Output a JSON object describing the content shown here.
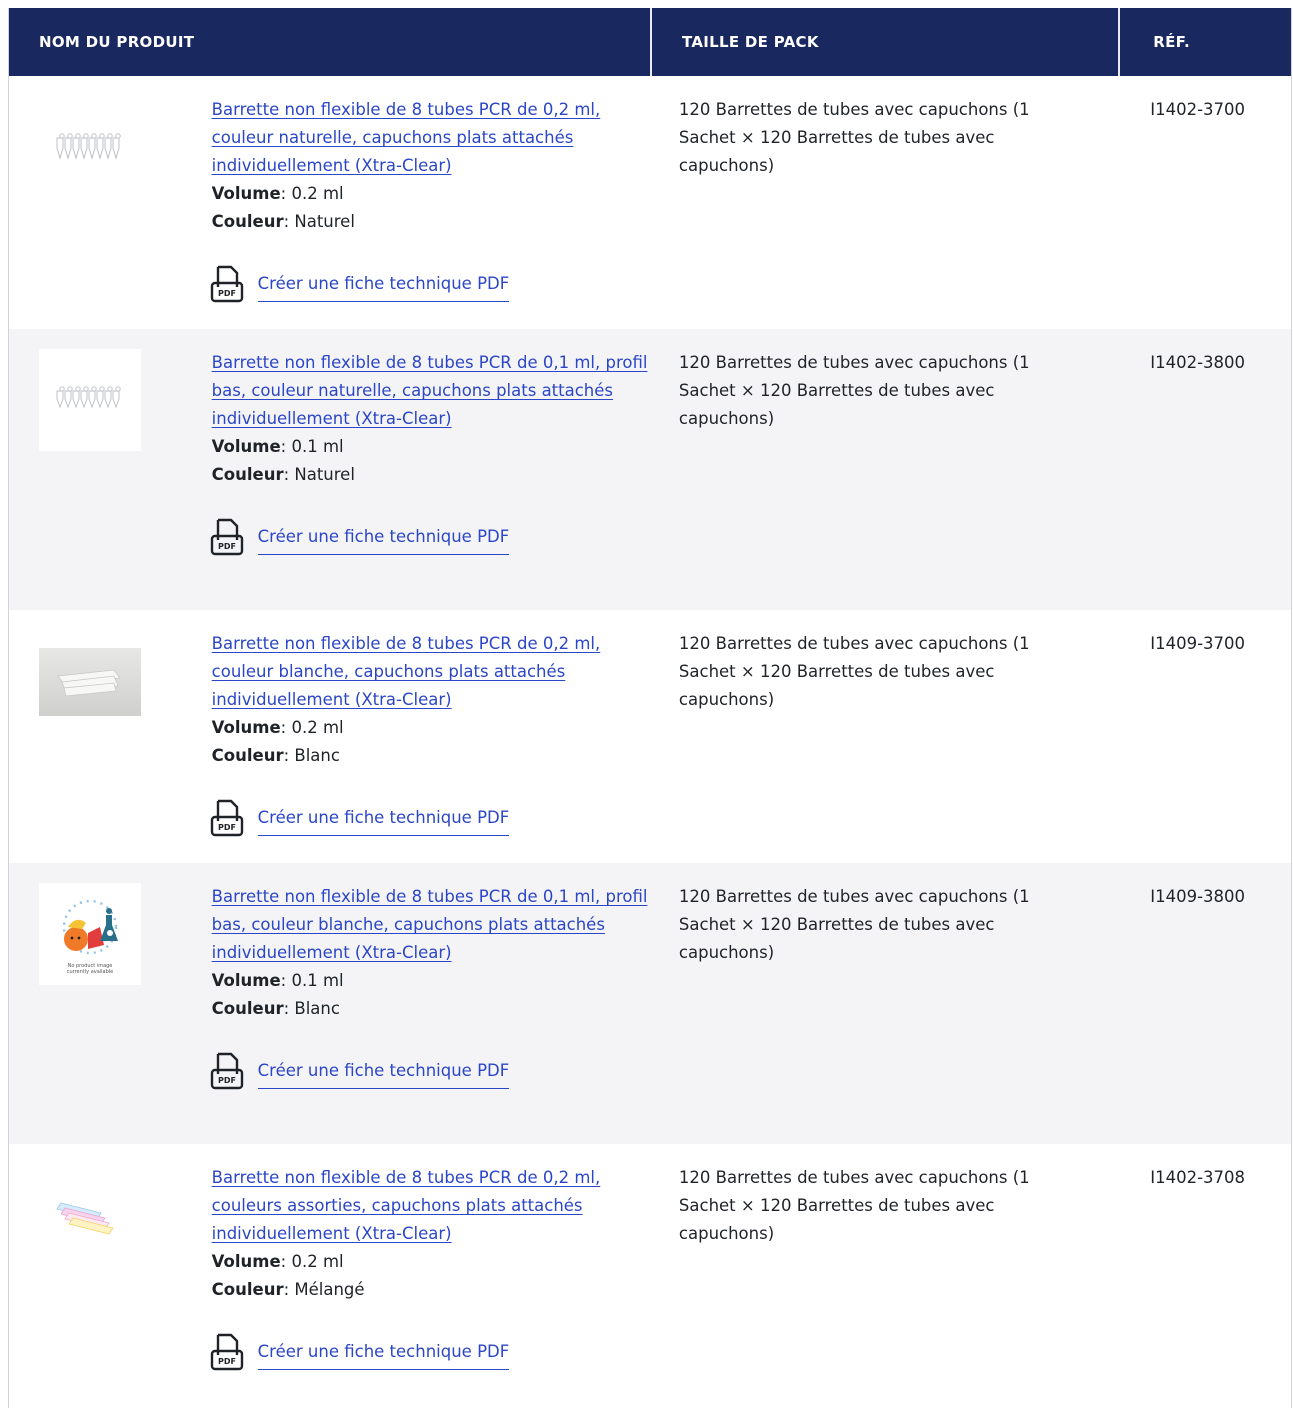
{
  "header": {
    "product_name": "NOM DU PRODUIT",
    "pack_size": "TAILLE DE PACK",
    "ref": "RÉF."
  },
  "labels": {
    "volume": "Volume",
    "color": "Couleur",
    "pdf_link": "Créer une fiche technique PDF",
    "no_image_line1": "No product image",
    "no_image_line2": "currently available"
  },
  "rows": [
    {
      "name": "Barrette non flexible de 8 tubes PCR de 0,2 ml, couleur naturelle, capuchons plats attachés individuellement (Xtra-Clear)",
      "volume": ": 0.2 ml",
      "color": ": Naturel",
      "pack": "120 Barrettes de tubes avec capuchons (1 Sachet × 120 Barrettes de tubes avec capuchons)",
      "ref": "I1402-3700",
      "image": "clear-tube-strip-icon"
    },
    {
      "name": "Barrette non flexible de 8 tubes PCR de 0,1 ml, profil bas, couleur naturelle, capuchons plats attachés individuellement (Xtra-Clear)",
      "volume": ": 0.1 ml",
      "color": ": Naturel",
      "pack": "120 Barrettes de tubes avec capuchons (1 Sachet × 120 Barrettes de tubes avec capuchons)",
      "ref": "I1402-3800",
      "image": "clear-tube-strip-icon"
    },
    {
      "name": "Barrette non flexible de 8 tubes PCR de 0,2 ml, couleur blanche, capuchons plats attachés individuellement (Xtra-Clear)",
      "volume": ": 0.2 ml",
      "color": ": Blanc",
      "pack": "120 Barrettes de tubes avec capuchons (1 Sachet × 120 Barrettes de tubes avec capuchons)",
      "ref": "I1409-3700",
      "image": "white-tube-strip-photo"
    },
    {
      "name": "Barrette non flexible de 8 tubes PCR de 0,1 ml, profil bas, couleur blanche, capuchons plats attachés individuellement (Xtra-Clear)",
      "volume": ": 0.1 ml",
      "color": ": Blanc",
      "pack": "120 Barrettes de tubes avec capuchons (1 Sachet × 120 Barrettes de tubes avec capuchons)",
      "ref": "I1409-3800",
      "image": "no-image-placeholder"
    },
    {
      "name": "Barrette non flexible de 8 tubes PCR de 0,2 ml, couleurs assorties, capuchons plats attachés individuellement (Xtra-Clear)",
      "volume": ": 0.2 ml",
      "color": ": Mélangé",
      "pack": "120 Barrettes de tubes avec capuchons (1 Sachet × 120 Barrettes de tubes avec capuchons)",
      "ref": "I1402-3708",
      "image": "assorted-color-tube-strips-icon"
    }
  ],
  "colors": {
    "header_bg": "#1a2860",
    "link": "#2b46c6",
    "alt_row": "#f4f4f7"
  }
}
